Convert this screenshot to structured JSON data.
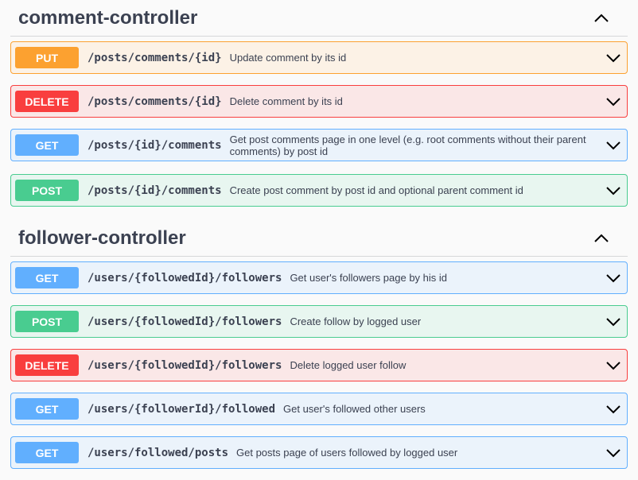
{
  "sections": [
    {
      "title": "comment-controller",
      "operations": [
        {
          "method": "PUT",
          "path": "/posts/comments/{id}",
          "summary": "Update comment by its id"
        },
        {
          "method": "DELETE",
          "path": "/posts/comments/{id}",
          "summary": "Delete comment by its id"
        },
        {
          "method": "GET",
          "path": "/posts/{id}/comments",
          "summary": "Get post comments page in one level (e.g. root comments without their parent comments) by post id"
        },
        {
          "method": "POST",
          "path": "/posts/{id}/comments",
          "summary": "Create post comment by post id and optional parent comment id"
        }
      ]
    },
    {
      "title": "follower-controller",
      "operations": [
        {
          "method": "GET",
          "path": "/users/{followedId}/followers",
          "summary": "Get user's followers page by his id"
        },
        {
          "method": "POST",
          "path": "/users/{followedId}/followers",
          "summary": "Create follow by logged user"
        },
        {
          "method": "DELETE",
          "path": "/users/{followedId}/followers",
          "summary": "Delete logged user follow"
        },
        {
          "method": "GET",
          "path": "/users/{followerId}/followed",
          "summary": "Get user's followed other users"
        },
        {
          "method": "GET",
          "path": "/users/followed/posts",
          "summary": "Get posts page of users followed by logged user"
        }
      ]
    }
  ],
  "colors": {
    "put": "#fca130",
    "delete": "#f93e3e",
    "get": "#61affe",
    "post": "#49cc90"
  }
}
